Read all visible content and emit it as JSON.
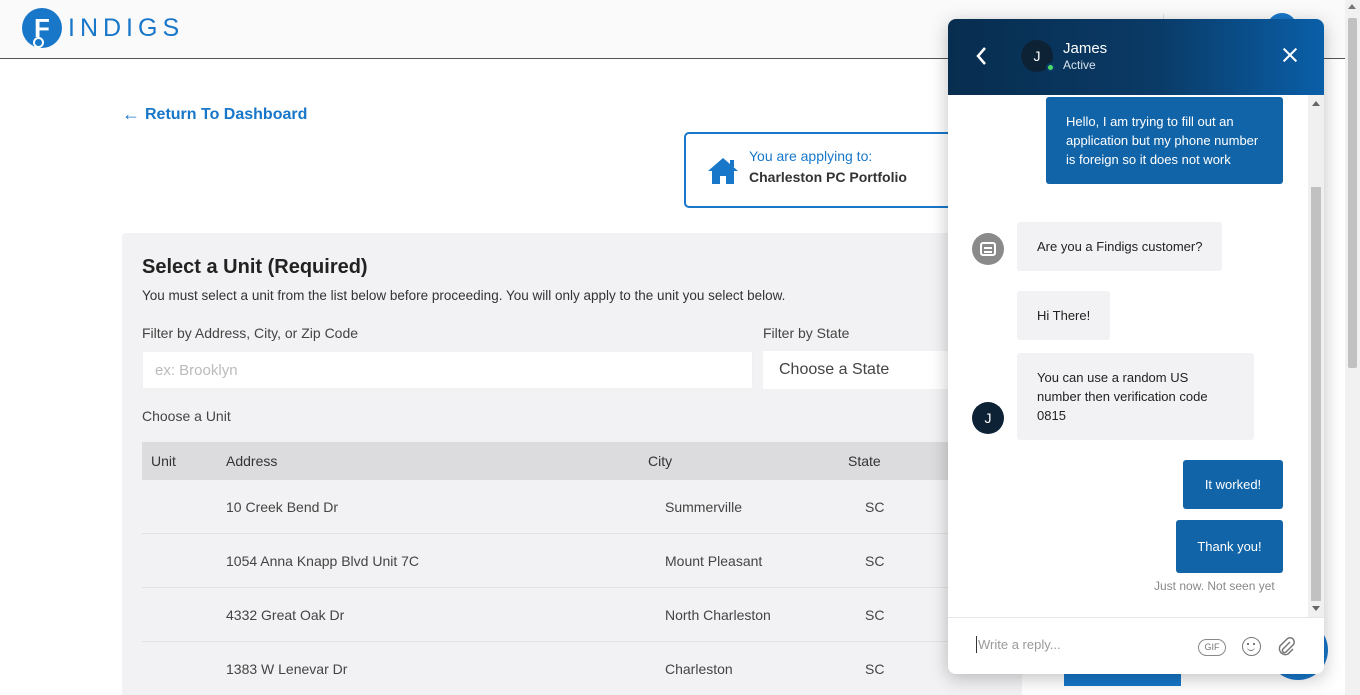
{
  "header": {
    "logo_letter": "F",
    "logo_text": "INDIGS"
  },
  "nav": {
    "return_label": "Return To Dashboard"
  },
  "apply_box": {
    "label": "You are applying to:",
    "property": "Charleston PC Portfolio"
  },
  "unit_card": {
    "title": "Select a Unit (Required)",
    "description": "You must select a unit from the list below before proceeding. You will only apply to the unit you select below.",
    "filter_address_label": "Filter by Address, City, or Zip Code",
    "filter_address_placeholder": "ex: Brooklyn",
    "filter_state_label": "Filter by State",
    "state_select_value": "Choose a State",
    "choose_unit_label": "Choose a Unit",
    "columns": [
      "Unit",
      "Address",
      "City",
      "State"
    ],
    "rows": [
      {
        "unit": "",
        "address": "10 Creek Bend Dr",
        "city": "Summerville",
        "state": "SC"
      },
      {
        "unit": "",
        "address": "1054 Anna Knapp Blvd Unit 7C",
        "city": "Mount Pleasant",
        "state": "SC"
      },
      {
        "unit": "",
        "address": "4332 Great Oak Dr",
        "city": "North Charleston",
        "state": "SC"
      },
      {
        "unit": "",
        "address": "1383 W Lenevar Dr",
        "city": "Charleston",
        "state": "SC"
      }
    ]
  },
  "chat": {
    "agent_initial": "J",
    "agent_name": "James",
    "agent_status": "Active",
    "messages": [
      {
        "from": "user",
        "text": "Hello, I am trying to fill out an application but my phone number is foreign so it does not work"
      },
      {
        "from": "bot",
        "text": "Are you a Findigs customer?"
      },
      {
        "from": "agent",
        "text": "Hi There!"
      },
      {
        "from": "agent",
        "text": "You can use a random US number then verification code 0815"
      },
      {
        "from": "user",
        "text": "It worked!"
      },
      {
        "from": "user",
        "text": "Thank you!"
      }
    ],
    "seen_status": "Just now. Not seen yet",
    "reply_placeholder": "Write a reply...",
    "gif_label": "GIF"
  },
  "colors": {
    "brand": "#1877c9",
    "chat_header": "#0a3a66",
    "user_bubble": "#1164a8",
    "bot_bubble": "#f2f2f4"
  },
  "icons": [
    "arrow-left-icon",
    "house-icon",
    "chevron-left-icon",
    "close-icon",
    "bot-icon",
    "emoji-icon",
    "attachment-icon",
    "gif-icon"
  ]
}
